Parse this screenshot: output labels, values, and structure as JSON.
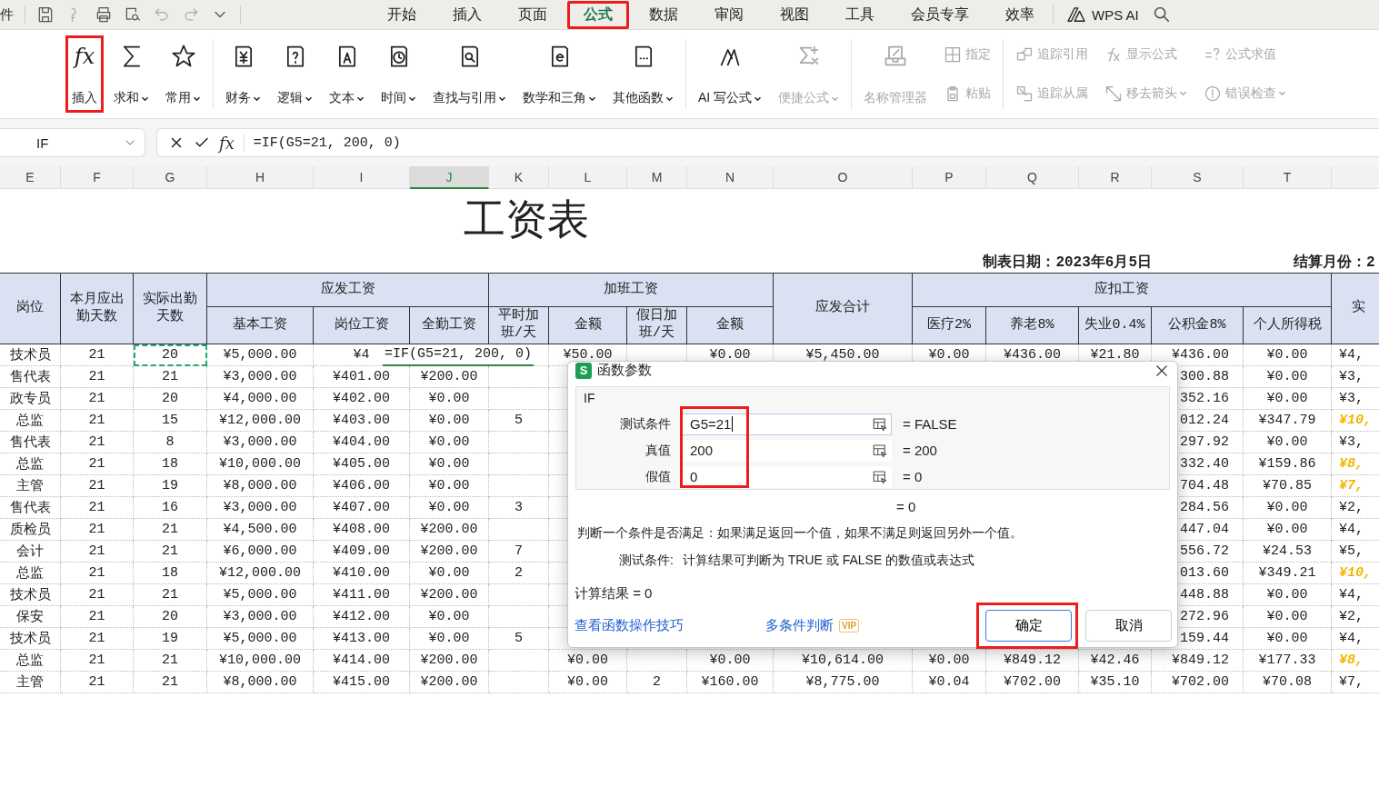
{
  "menu": {
    "file": "件",
    "tabs": [
      {
        "label": "开始",
        "selected": false,
        "highlighted": false
      },
      {
        "label": "插入",
        "selected": false,
        "highlighted": false
      },
      {
        "label": "页面",
        "selected": false,
        "highlighted": false
      },
      {
        "label": "公式",
        "selected": true,
        "highlighted": true
      },
      {
        "label": "数据",
        "selected": false,
        "highlighted": false
      },
      {
        "label": "审阅",
        "selected": false,
        "highlighted": false
      },
      {
        "label": "视图",
        "selected": false,
        "highlighted": false
      },
      {
        "label": "工具",
        "selected": false,
        "highlighted": false
      },
      {
        "label": "会员专享",
        "selected": false,
        "highlighted": false
      },
      {
        "label": "效率",
        "selected": false,
        "highlighted": false
      }
    ],
    "ai_label": "WPS AI"
  },
  "ribbon": {
    "groups": [
      {
        "items": [
          {
            "label": "插入",
            "icon_text": "fx",
            "kind": "large",
            "dropdown": false,
            "disabled": false,
            "highlighted": true
          },
          {
            "label": "求和",
            "kind": "large",
            "dropdown": true,
            "disabled": false,
            "highlighted": false
          },
          {
            "label": "常用",
            "kind": "large",
            "dropdown": true,
            "disabled": false,
            "highlighted": false
          }
        ]
      },
      {
        "items": [
          {
            "label": "财务",
            "kind": "large",
            "dropdown": true,
            "disabled": false,
            "highlighted": false
          },
          {
            "label": "逻辑",
            "kind": "large",
            "dropdown": true,
            "disabled": false,
            "highlighted": false
          },
          {
            "label": "文本",
            "kind": "large",
            "dropdown": true,
            "disabled": false,
            "highlighted": false
          },
          {
            "label": "时间",
            "kind": "large",
            "dropdown": true,
            "disabled": false,
            "highlighted": false
          },
          {
            "label": "查找与引用",
            "kind": "large",
            "dropdown": true,
            "disabled": false,
            "highlighted": false
          },
          {
            "label": "数学和三角",
            "kind": "large",
            "dropdown": true,
            "disabled": false,
            "highlighted": false
          },
          {
            "label": "其他函数",
            "kind": "large",
            "dropdown": true,
            "disabled": false,
            "highlighted": false
          }
        ]
      },
      {
        "items": [
          {
            "label": "AI 写公式",
            "kind": "large",
            "dropdown": true,
            "disabled": false,
            "highlighted": false
          },
          {
            "label": "便捷公式",
            "kind": "large",
            "dropdown": true,
            "disabled": true,
            "highlighted": false
          }
        ]
      },
      {
        "items": [
          {
            "label": "名称管理器",
            "kind": "large",
            "dropdown": false,
            "disabled": true,
            "highlighted": false
          },
          {
            "label": "指定",
            "kind": "small",
            "dropdown": false,
            "disabled": true,
            "highlighted": false
          },
          {
            "label": "粘贴",
            "kind": "small",
            "dropdown": false,
            "disabled": true,
            "highlighted": false
          }
        ]
      },
      {
        "items": [
          {
            "label": "追踪引用",
            "kind": "small",
            "dropdown": false,
            "disabled": true,
            "highlighted": false
          },
          {
            "label": "追踪从属",
            "kind": "small",
            "dropdown": false,
            "disabled": true,
            "highlighted": false
          },
          {
            "label": "显示公式",
            "kind": "small",
            "dropdown": false,
            "disabled": true,
            "highlighted": false
          },
          {
            "label": "移去箭头",
            "kind": "small",
            "dropdown": true,
            "disabled": true,
            "highlighted": false
          },
          {
            "label": "公式求值",
            "kind": "small",
            "dropdown": false,
            "disabled": true,
            "highlighted": false
          },
          {
            "label": "错误检查",
            "kind": "small",
            "dropdown": true,
            "disabled": true,
            "highlighted": false
          }
        ]
      }
    ]
  },
  "formula_bar": {
    "name_box": "IF",
    "fx": "fx",
    "formula": "=IF(G5=21, 200, 0)"
  },
  "sheet": {
    "column_letters": [
      {
        "label": "E",
        "selected": false
      },
      {
        "label": "F",
        "selected": false
      },
      {
        "label": "G",
        "selected": false
      },
      {
        "label": "H",
        "selected": false
      },
      {
        "label": "I",
        "selected": false
      },
      {
        "label": "J",
        "selected": true
      },
      {
        "label": "K",
        "selected": false
      },
      {
        "label": "L",
        "selected": false
      },
      {
        "label": "M",
        "selected": false
      },
      {
        "label": "N",
        "selected": false
      },
      {
        "label": "O",
        "selected": false
      },
      {
        "label": "P",
        "selected": false
      },
      {
        "label": "Q",
        "selected": false
      },
      {
        "label": "R",
        "selected": false
      },
      {
        "label": "S",
        "selected": false
      },
      {
        "label": "T",
        "selected": false
      }
    ],
    "title": "工资表",
    "date": "制表日期：2023年6月5日",
    "month": "结算月份：2",
    "headers": [
      {
        "label": "岗位"
      },
      {
        "label": "本月应出勤天数"
      },
      {
        "label": "实际出勤天数"
      },
      {
        "label": "应发工资",
        "children": [
          "基本工资",
          "岗位工资",
          "全勤工资"
        ]
      },
      {
        "label": "加班工资",
        "children": [
          "平时加班/天",
          "金额",
          "假日加班/天",
          "金额"
        ]
      },
      {
        "label": "应发合计"
      },
      {
        "label": "应扣工资",
        "children": [
          "医疗2%",
          "养老8%",
          "失业0.4%",
          "公积金8%",
          "个人所得税"
        ]
      },
      {
        "label": "实"
      }
    ],
    "rows": [
      [
        "技术员",
        "21",
        {
          "text": "20",
          "referenced": true
        },
        "¥5,000.00",
        "¥4",
        {
          "text": "=IF(G5=21, 200, 0)",
          "editing": true
        },
        null,
        "¥50.00",
        null,
        "¥0.00",
        "¥5,450.00",
        "¥0.00",
        "¥436.00",
        "¥21.80",
        "¥436.00",
        "¥0.00",
        "¥4,"
      ],
      [
        "售代表",
        "21",
        "21",
        "¥3,000.00",
        "¥401.00",
        "¥200.00",
        null,
        null,
        null,
        null,
        null,
        null,
        null,
        null,
        "300.88",
        "¥0.00",
        "¥3,"
      ],
      [
        "政专员",
        "21",
        "20",
        "¥4,000.00",
        "¥402.00",
        "¥0.00",
        null,
        null,
        null,
        null,
        null,
        null,
        null,
        null,
        "352.16",
        "¥0.00",
        "¥3,"
      ],
      [
        "总监",
        "21",
        "15",
        "¥12,000.00",
        "¥403.00",
        "¥0.00",
        "5",
        null,
        null,
        null,
        null,
        null,
        null,
        null,
        "012.24",
        "¥347.79",
        {
          "text": "¥10,",
          "highlight": true
        }
      ],
      [
        "售代表",
        "21",
        "8",
        "¥3,000.00",
        "¥404.00",
        "¥0.00",
        null,
        null,
        null,
        null,
        null,
        null,
        null,
        null,
        "297.92",
        "¥0.00",
        "¥3,"
      ],
      [
        "总监",
        "21",
        "18",
        "¥10,000.00",
        "¥405.00",
        "¥0.00",
        null,
        null,
        null,
        null,
        null,
        null,
        null,
        null,
        "332.40",
        "¥159.86",
        {
          "text": "¥8,",
          "highlight": true
        }
      ],
      [
        "主管",
        "21",
        "19",
        "¥8,000.00",
        "¥406.00",
        "¥0.00",
        null,
        null,
        null,
        null,
        null,
        null,
        null,
        null,
        "704.48",
        "¥70.85",
        {
          "text": "¥7,",
          "highlight": true
        }
      ],
      [
        "售代表",
        "21",
        "16",
        "¥3,000.00",
        "¥407.00",
        "¥0.00",
        "3",
        null,
        null,
        null,
        null,
        null,
        null,
        null,
        "284.56",
        "¥0.00",
        "¥2,"
      ],
      [
        "质检员",
        "21",
        "21",
        "¥4,500.00",
        "¥408.00",
        "¥200.00",
        null,
        null,
        null,
        null,
        null,
        null,
        null,
        null,
        "447.04",
        "¥0.00",
        "¥4,"
      ],
      [
        "会计",
        "21",
        "21",
        "¥6,000.00",
        "¥409.00",
        "¥200.00",
        "7",
        null,
        null,
        null,
        null,
        null,
        null,
        null,
        "556.72",
        "¥24.53",
        "¥5,"
      ],
      [
        "总监",
        "21",
        "18",
        "¥12,000.00",
        "¥410.00",
        "¥0.00",
        "2",
        null,
        null,
        null,
        null,
        null,
        null,
        null,
        "013.60",
        "¥349.21",
        {
          "text": "¥10,",
          "highlight": true
        }
      ],
      [
        "技术员",
        "21",
        "21",
        "¥5,000.00",
        "¥411.00",
        "¥200.00",
        null,
        null,
        null,
        null,
        null,
        null,
        null,
        null,
        "448.88",
        "¥0.00",
        "¥4,"
      ],
      [
        "保安",
        "21",
        "20",
        "¥3,000.00",
        "¥412.00",
        "¥0.00",
        null,
        null,
        null,
        null,
        null,
        null,
        null,
        null,
        "272.96",
        "¥0.00",
        "¥2,"
      ],
      [
        "技术员",
        "21",
        "19",
        "¥5,000.00",
        "¥413.00",
        "¥0.00",
        "5",
        null,
        null,
        null,
        null,
        null,
        null,
        null,
        "159.44",
        "¥0.00",
        "¥4,"
      ],
      [
        "总监",
        "21",
        "21",
        "¥10,000.00",
        "¥414.00",
        "¥200.00",
        null,
        "¥0.00",
        null,
        "¥0.00",
        "¥10,614.00",
        "¥0.00",
        "¥849.12",
        "¥42.46",
        "¥849.12",
        "¥177.33",
        {
          "text": "¥8,",
          "highlight": true
        }
      ],
      [
        "主管",
        "21",
        "21",
        "¥8,000.00",
        "¥415.00",
        "¥200.00",
        null,
        "¥0.00",
        "2",
        "¥160.00",
        "¥8,775.00",
        "¥0.04",
        "¥702.00",
        "¥35.10",
        "¥702.00",
        "¥70.08",
        "¥7,"
      ]
    ]
  },
  "dialog": {
    "badge": "S",
    "title": "函数参数",
    "function_name": "IF",
    "args": [
      {
        "label": "测试条件",
        "value": "G5=21",
        "result": "= FALSE",
        "focused": true
      },
      {
        "label": "真值",
        "value": "200",
        "result": "= 200",
        "focused": false
      },
      {
        "label": "假值",
        "value": "0",
        "result": "= 0",
        "focused": false
      }
    ],
    "args_highlighted": true,
    "formula_result": "= 0",
    "description": "判断一个条件是否满足：如果满足返回一个值，如果不满足则返回另外一个值。",
    "arg_help_label": "测试条件:",
    "arg_help": "计算结果可判断为 TRUE 或 FALSE 的数值或表达式",
    "calc_result": "计算结果 = 0",
    "tips_link": "查看函数操作技巧",
    "feature_link": "多条件判断",
    "vip": "VIP",
    "buttons": [
      {
        "label": "确定",
        "primary": true,
        "highlighted": true
      },
      {
        "label": "取消",
        "primary": false,
        "highlighted": false
      }
    ]
  }
}
